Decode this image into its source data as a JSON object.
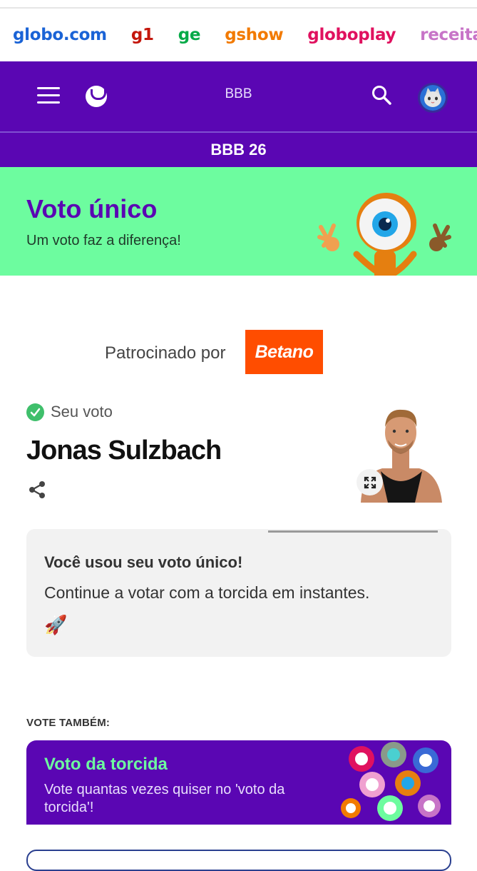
{
  "portal": {
    "links": [
      {
        "label": "globo.com",
        "color": "#1a63d6"
      },
      {
        "label": "g1",
        "color": "#c4170c"
      },
      {
        "label": "ge",
        "color": "#06aa48"
      },
      {
        "label": "gshow",
        "color": "#f27a00"
      },
      {
        "label": "globoplay",
        "color": "#e0115f"
      },
      {
        "label": "receitas",
        "color": "#c774c7"
      }
    ]
  },
  "header": {
    "title": "BBB",
    "menu_icon": "hamburger-menu-icon",
    "logo_icon": "bbb-smile-logo-icon",
    "search_icon": "search-icon",
    "avatar_icon": "cat-avatar-icon"
  },
  "subnav": {
    "title": "BBB 26"
  },
  "banner": {
    "title": "Voto único",
    "subtitle": "Um voto faz a diferença!"
  },
  "sponsor": {
    "label": "Patrocinado por",
    "brand": "Betano"
  },
  "vote": {
    "status_label": "Seu voto",
    "candidate_name": "Jonas Sulzbach"
  },
  "info_card": {
    "title": "Você usou seu voto único!",
    "body": "Continue a votar com a torcida em instantes.",
    "emoji": "🚀"
  },
  "also": {
    "label": "VOTE TAMBÉM:",
    "promo_title": "Voto da torcida",
    "promo_body": "Vote quantas vezes quiser no 'voto da torcida'!"
  },
  "colors": {
    "brand_purple": "#5a06b3",
    "brand_green": "#6dfc9f",
    "sponsor_orange": "#ff4d00"
  }
}
